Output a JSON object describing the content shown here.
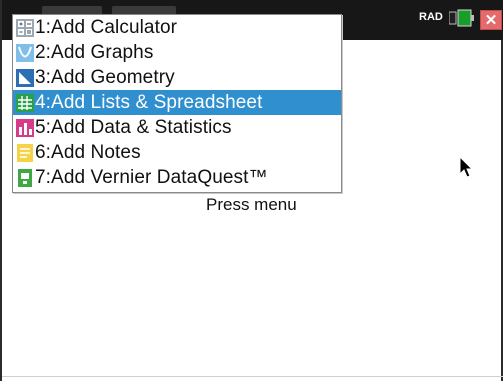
{
  "status": {
    "angle_mode": "RAD"
  },
  "menu": {
    "items": [
      {
        "label": "1:Add Calculator",
        "icon": "calculator-icon",
        "selected": false
      },
      {
        "label": "2:Add Graphs",
        "icon": "graphs-icon",
        "selected": false
      },
      {
        "label": "3:Add Geometry",
        "icon": "geometry-icon",
        "selected": false
      },
      {
        "label": "4:Add Lists & Spreadsheet",
        "icon": "spreadsheet-icon",
        "selected": true
      },
      {
        "label": "5:Add Data & Statistics",
        "icon": "data-statistics-icon",
        "selected": false
      },
      {
        "label": "6:Add Notes",
        "icon": "notes-icon",
        "selected": false
      },
      {
        "label": "7:Add Vernier DataQuest™",
        "icon": "vernier-dataquest-icon",
        "selected": false
      }
    ]
  },
  "hint": {
    "text": "Press menu"
  },
  "colors": {
    "topbar": "#171717",
    "selection": "#2f8fcf",
    "close_button": "#e36b6b"
  }
}
